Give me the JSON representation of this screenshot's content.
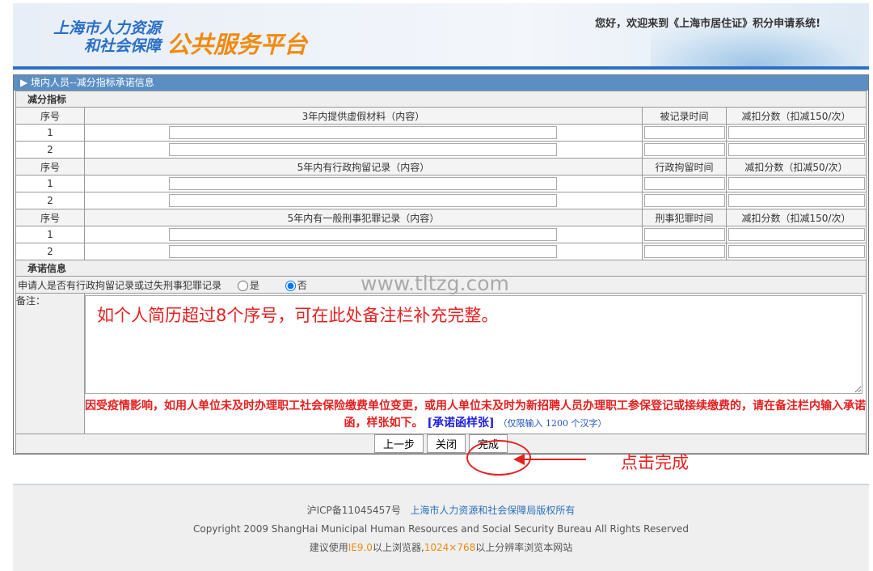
{
  "header": {
    "logo_line1": "上海市人力资源",
    "logo_line2": "和社会保障",
    "logo_main": "公共服务平台",
    "welcome": "您好，欢迎来到《上海市居住证》积分申请系统!"
  },
  "panel": {
    "title": "境内人员--减分指标承诺信息",
    "section1": "减分指标",
    "seq_label": "序号",
    "groups": [
      {
        "content": "3年内提供虚假材料（内容）",
        "time": "被记录时间",
        "score": "减扣分数（扣减150/次）",
        "rows": [
          "1",
          "2"
        ]
      },
      {
        "content": "5年内有行政拘留记录（内容）",
        "time": "行政拘留时间",
        "score": "减扣分数（扣减50/次）",
        "rows": [
          "1",
          "2"
        ]
      },
      {
        "content": "5年内有一般刑事犯罪记录（内容）",
        "time": "刑事犯罪时间",
        "score": "减扣分数（扣减150/次）",
        "rows": [
          "1",
          "2"
        ]
      }
    ],
    "section2": "承诺信息",
    "question": "申请人是否有行政拘留记录或过失刑事犯罪记录",
    "yes": "是",
    "no": "否",
    "note_label": "备注：",
    "note_value": "如个人简历超过8个序号，可在此处备注栏补充完整。",
    "warning": "因受疫情影响，如用人单位未及时办理职工社会保险缴费单位变更，或用人单位未及时为新招聘人员办理职工参保登记或接续缴费的，请在备注栏内输入承诺函，样张如下。",
    "sample_link": "[承诺函样张]",
    "limit": "（仅限输入 1200 个汉字）",
    "btn_prev": "上一步",
    "btn_close": "关闭",
    "btn_done": "完成"
  },
  "annotation": "点击完成",
  "watermark": "www.tltzg.com",
  "footer": {
    "icp": "沪ICP备11045457号",
    "owner": "上海市人力资源和社会保障局版权所有",
    "copyright": "Copyright 2009 ShangHai Municipal Human Resources and Social Security Bureau All Rights Reserved",
    "browser_pre": "建议使用",
    "ie": "IE9.0",
    "browser_mid": "以上浏览器,",
    "res": "1024×768",
    "browser_post": "以上分辨率浏览本网站"
  }
}
